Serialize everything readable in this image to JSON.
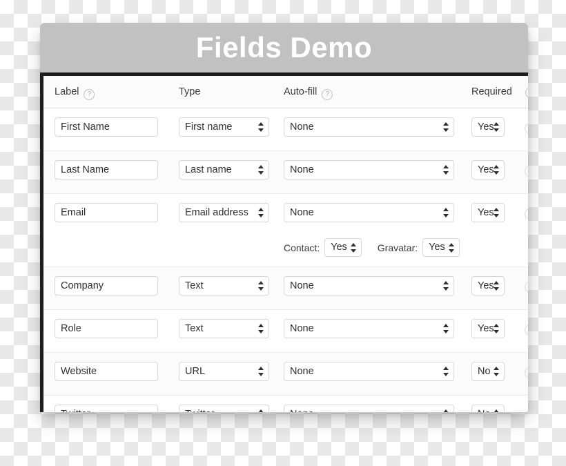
{
  "window": {
    "title": "Fields Demo"
  },
  "table": {
    "columns": [
      {
        "key": "label",
        "label": "Label",
        "help_icon": "question-mark-circle-icon",
        "has_help": true
      },
      {
        "key": "type",
        "label": "Type",
        "has_help": false
      },
      {
        "key": "autofill",
        "label": "Auto-fill",
        "help_icon": "question-mark-circle-icon",
        "has_help": true
      },
      {
        "key": "required",
        "label": "Required",
        "has_help": false
      }
    ],
    "help_glyph": "?",
    "rows": [
      {
        "label": "First Name",
        "type": "First name",
        "autofill": "None",
        "required": "Yes",
        "sub_options": []
      },
      {
        "label": "Last Name",
        "type": "Last name",
        "autofill": "None",
        "required": "Yes",
        "sub_options": []
      },
      {
        "label": "Email",
        "type": "Email address",
        "autofill": "None",
        "required": "Yes",
        "sub_options": [
          {
            "label": "Contact:",
            "value": "Yes"
          },
          {
            "label": "Gravatar:",
            "value": "Yes"
          }
        ]
      },
      {
        "label": "Company",
        "type": "Text",
        "autofill": "None",
        "required": "Yes",
        "sub_options": []
      },
      {
        "label": "Role",
        "type": "Text",
        "autofill": "None",
        "required": "Yes",
        "sub_options": []
      },
      {
        "label": "Website",
        "type": "URL",
        "autofill": "None",
        "required": "No",
        "sub_options": []
      },
      {
        "label": "Twitter",
        "type": "Twitter",
        "autofill": "None",
        "required": "No",
        "sub_options": []
      }
    ]
  },
  "colors": {
    "titlebar_background": "#c1c1c1",
    "titlebar_text": "#ffffff",
    "panel_background": "#ffffff",
    "row_alt_background": "#fbfbfb",
    "frame_border": "#1d1d1d",
    "control_border": "#d7d7d7",
    "text": "#303030",
    "help_icon": "#b3b3b3"
  }
}
